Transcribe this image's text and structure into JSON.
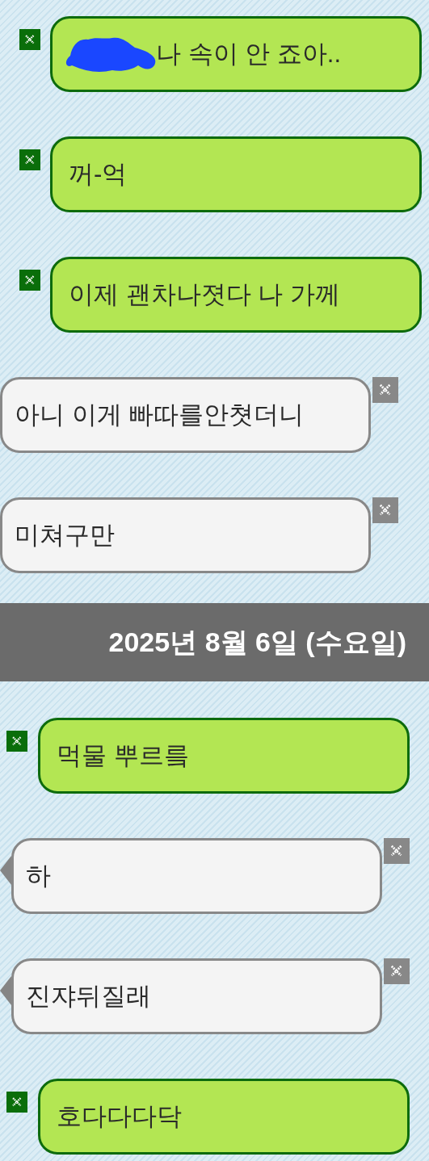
{
  "groups": [
    {
      "messages": [
        {
          "kind": "sent",
          "text": "나 속이 안 죠아..",
          "redacted": true
        },
        {
          "kind": "sent",
          "text": "꺼-억",
          "redacted": false
        },
        {
          "kind": "sent",
          "text": "이제 괜차나졋다 나 가께",
          "redacted": false
        },
        {
          "kind": "received",
          "text": "아니 이게 빠따를안쳣더니",
          "tail": false
        },
        {
          "kind": "received",
          "text": "미쳐구만",
          "tail": false
        }
      ]
    },
    {
      "date": "2025년 8월 6일 (수요일)",
      "messages": [
        {
          "kind": "sent",
          "text": "먹물 뿌르릌",
          "redacted": false
        },
        {
          "kind": "received",
          "text": "하",
          "tail": true
        },
        {
          "kind": "received",
          "text": "진쟈뒤질래",
          "tail": true
        },
        {
          "kind": "sent",
          "text": "호다다다닥",
          "redacted": false
        }
      ]
    }
  ]
}
